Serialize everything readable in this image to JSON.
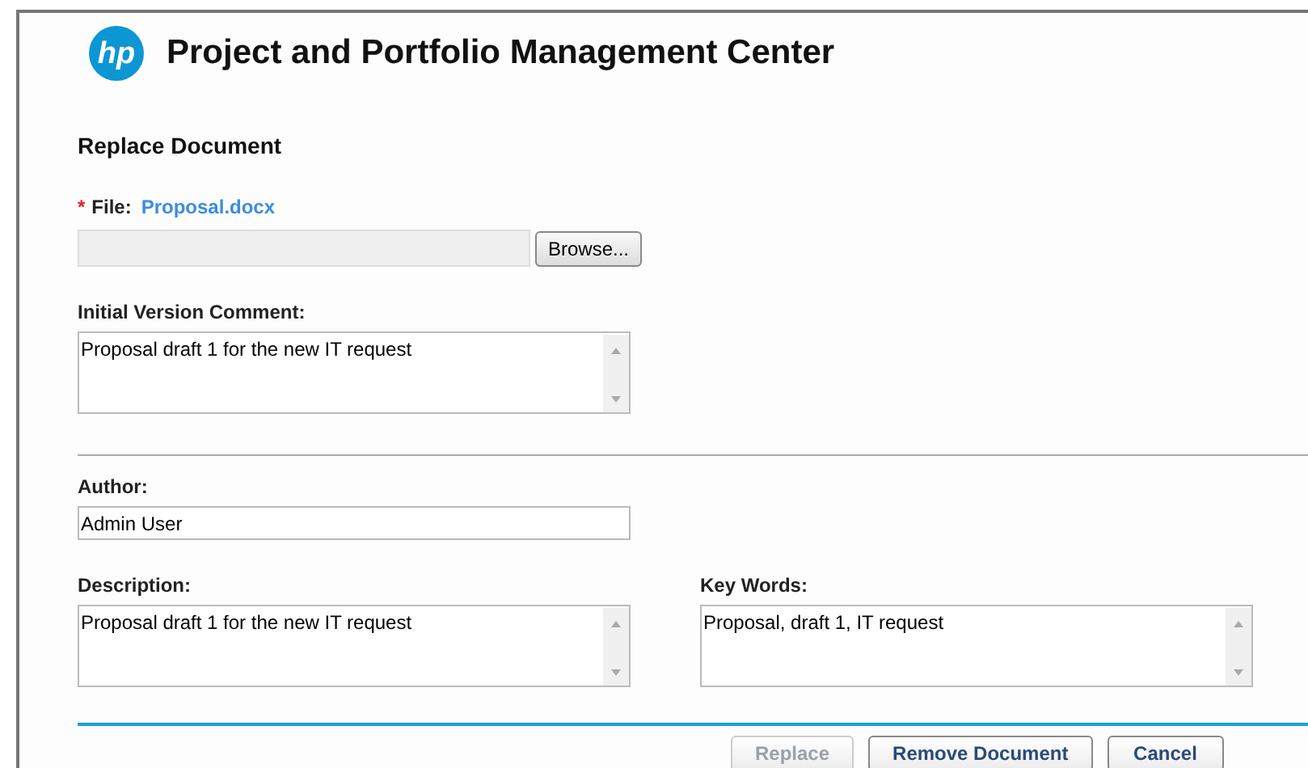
{
  "header": {
    "logo_text": "hp",
    "title": "Project and Portfolio Management Center"
  },
  "form": {
    "heading": "Replace Document",
    "file": {
      "label": "File:",
      "required_mark": "*",
      "link": "Proposal.docx",
      "browse": "Browse..."
    },
    "comment": {
      "label": "Initial Version Comment:",
      "value": "Proposal draft 1 for the new IT request"
    },
    "author": {
      "label": "Author:",
      "value": "Admin User"
    },
    "description": {
      "label": "Description:",
      "value": "Proposal draft 1 for the new IT request"
    },
    "keywords": {
      "label": "Key Words:",
      "value": "Proposal, draft 1, IT request"
    }
  },
  "buttons": [
    {
      "label": "Replace",
      "disabled": true
    },
    {
      "label": "Remove Document",
      "disabled": false
    },
    {
      "label": "Cancel",
      "disabled": false
    }
  ]
}
